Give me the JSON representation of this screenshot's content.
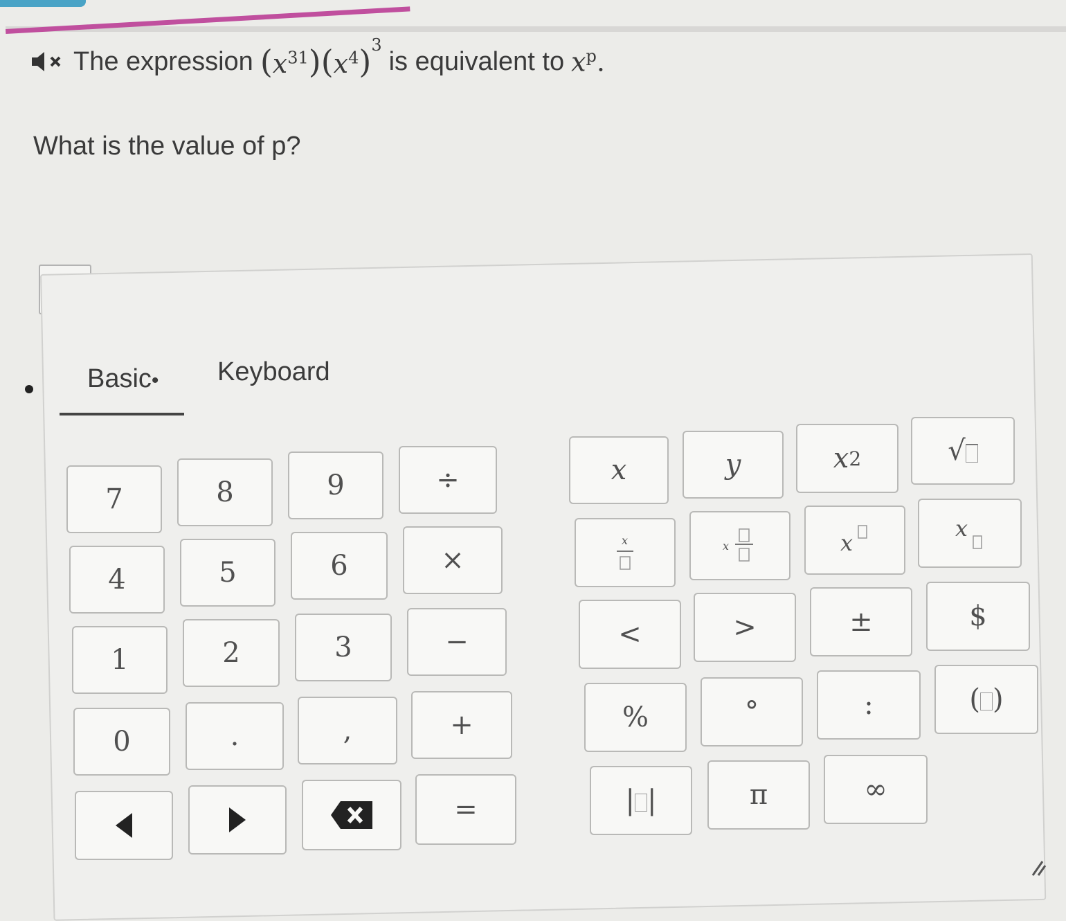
{
  "question": {
    "prefix": "The expression",
    "base": "x",
    "exp1": "31",
    "exp2": "4",
    "outer_exp": "3",
    "middle": "is equivalent to",
    "rhs_base": "x",
    "rhs_exp": "p",
    "end": ".",
    "prompt": "What is the value of p?"
  },
  "tabs": {
    "basic": "Basic",
    "basic_marker": "•",
    "keyboard": "Keyboard"
  },
  "keys": {
    "k7": "7",
    "k8": "8",
    "k9": "9",
    "divide": "÷",
    "k4": "4",
    "k5": "5",
    "k6": "6",
    "times": "×",
    "k1": "1",
    "k2": "2",
    "k3": "3",
    "minus": "−",
    "k0": "0",
    "dot": ".",
    "comma": ",",
    "plus": "+",
    "equals": "=",
    "x": "x",
    "y": "y",
    "x_squared_base": "x",
    "x_squared_exp": "2",
    "lt": "<",
    "gt": ">",
    "plusminus": "±",
    "dollar": "$",
    "percent": "%",
    "degree": "°",
    "colon": ":",
    "pi": "π",
    "infinity": "∞"
  },
  "icons": {
    "speaker": "speaker-mute-icon",
    "left": "left-arrow-icon",
    "right": "right-arrow-icon",
    "backspace": "backspace-icon",
    "resize": "resize-handle-icon"
  }
}
